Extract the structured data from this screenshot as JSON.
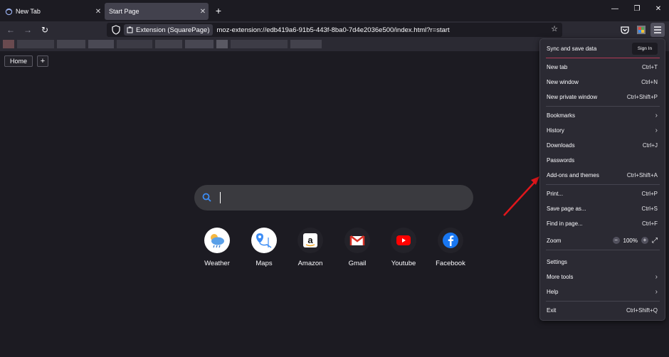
{
  "tabs": [
    {
      "label": "New Tab",
      "close": "✕"
    },
    {
      "label": "Start Page",
      "close": "✕"
    }
  ],
  "new_tab_symbol": "+",
  "window_controls": {
    "minimize": "—",
    "maximize": "❐",
    "close": "✕"
  },
  "nav": {
    "back": "←",
    "forward": "→",
    "reload": "↻",
    "extension_label": "Extension (SquarePage)",
    "url": "moz-extension://edb419a6-91b5-443f-8ba0-7d4e2036e500/index.html?r=start",
    "bookmark_star": "☆"
  },
  "content": {
    "home_tab": "Home",
    "add_tab": "+",
    "search_value": "",
    "shortcuts": [
      {
        "label": "Weather",
        "icon": "weather-icon"
      },
      {
        "label": "Maps",
        "icon": "maps-icon"
      },
      {
        "label": "Amazon",
        "icon": "amazon-icon"
      },
      {
        "label": "Gmail",
        "icon": "gmail-icon"
      },
      {
        "label": "Youtube",
        "icon": "youtube-icon"
      },
      {
        "label": "Facebook",
        "icon": "facebook-icon"
      }
    ]
  },
  "menu": {
    "sync_label": "Sync and save data",
    "sign_in": "Sign In",
    "items": [
      {
        "label": "New tab",
        "shortcut": "Ctrl+T"
      },
      {
        "label": "New window",
        "shortcut": "Ctrl+N"
      },
      {
        "label": "New private window",
        "shortcut": "Ctrl+Shift+P"
      },
      {
        "label": "Bookmarks",
        "shortcut": ""
      },
      {
        "label": "History",
        "shortcut": ""
      },
      {
        "label": "Downloads",
        "shortcut": "Ctrl+J"
      },
      {
        "label": "Passwords",
        "shortcut": ""
      },
      {
        "label": "Add-ons and themes",
        "shortcut": "Ctrl+Shift+A"
      },
      {
        "label": "Print...",
        "shortcut": "Ctrl+P"
      },
      {
        "label": "Save page as...",
        "shortcut": "Ctrl+S"
      },
      {
        "label": "Find in page...",
        "shortcut": "Ctrl+F"
      },
      {
        "label": "Zoom",
        "shortcut": ""
      },
      {
        "label": "Settings",
        "shortcut": ""
      },
      {
        "label": "More tools",
        "shortcut": ""
      },
      {
        "label": "Help",
        "shortcut": ""
      },
      {
        "label": "Exit",
        "shortcut": "Ctrl+Shift+Q"
      }
    ],
    "zoom": {
      "minus": "−",
      "value": "100%",
      "plus": "+",
      "fullscreen": "⤢"
    }
  },
  "colors": {
    "annotation_arrow": "#e0161b",
    "search_icon": "#3d8df5"
  }
}
